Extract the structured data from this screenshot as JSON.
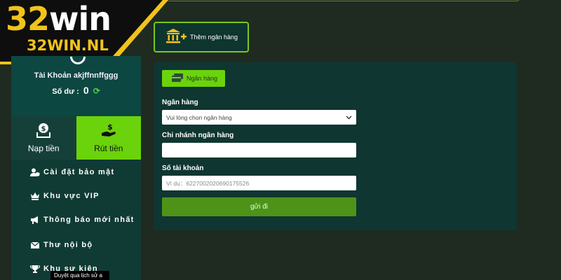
{
  "brand": {
    "name_num": "32",
    "name_word": "win",
    "domain": "32WIN.NL"
  },
  "account": {
    "name": "Tài Khoản akjffnnffggg",
    "balance_label": "Số dư :",
    "balance_value": "0",
    "refresh_glyph": "⟳"
  },
  "tabs": {
    "deposit": "Nạp tiền",
    "withdraw": "Rút tiền"
  },
  "menu": [
    {
      "label": "Cài đặt bảo mật",
      "icon": "user-shield-icon"
    },
    {
      "label": "Khu vực VIP",
      "icon": "crown-icon"
    },
    {
      "label": "Thông báo mới nhất",
      "icon": "megaphone-icon"
    },
    {
      "label": "Thư nội bộ",
      "icon": "envelope-icon"
    },
    {
      "label": "Khu sự kiện",
      "icon": "trophy-icon"
    }
  ],
  "tooltip": "Duyệt qua lịch sử a",
  "add_bank": {
    "label": "Thêm ngân hàng"
  },
  "form": {
    "tab_label": "Ngân hàng",
    "bank_label": "Ngân hàng",
    "bank_select": "Vui lòng chọn ngân hàng",
    "branch_label": "Chi nhánh ngân hàng",
    "branch_value": "",
    "account_label": "Số tài khoản",
    "account_placeholder": "Ví dụ：6227002020690175526",
    "submit": "gửi đi"
  },
  "colors": {
    "accent": "#6bd30b",
    "brand_yellow": "#f2c31b",
    "panel": "#0f3631",
    "bg": "#1f2b21"
  }
}
